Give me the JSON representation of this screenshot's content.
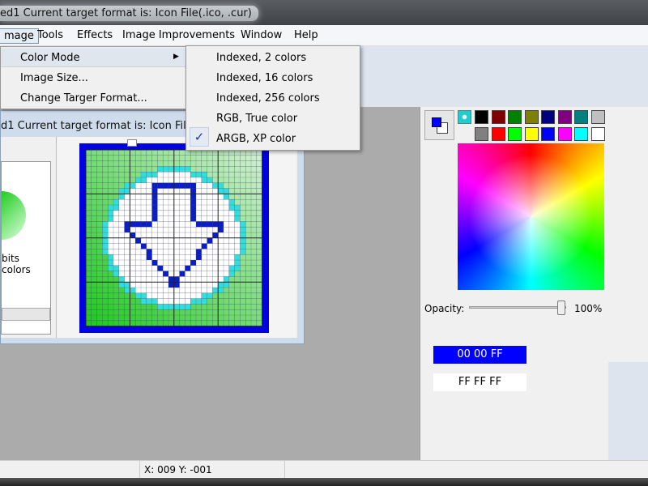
{
  "window": {
    "title": "ed1  Current target format is: Icon File(.ico, .cur)"
  },
  "menubar": [
    "mage",
    "Tools",
    "Effects",
    "Image Improvements",
    "Window",
    "Help"
  ],
  "image_menu": {
    "items": [
      "Color Mode",
      "Image Size...",
      "Change Targer Format..."
    ],
    "submenu_arrow": "triangle-right-icon"
  },
  "color_mode_submenu": {
    "items": [
      "Indexed, 2 colors",
      "Indexed, 16 colors",
      "Indexed, 256 colors",
      "RGB, True color",
      "ARGB, XP color"
    ],
    "checked": "ARGB, XP color"
  },
  "child_window": {
    "title": "d1  Current target format is: Icon File(.",
    "preview_label": "bits colors"
  },
  "palette": {
    "row1": [
      "#000000",
      "#800000",
      "#008000",
      "#808000",
      "#000080",
      "#800080",
      "#008080",
      "#c0c0c0"
    ],
    "row2": [
      "#808080",
      "#ff0000",
      "#00ff00",
      "#ffff00",
      "#0000ff",
      "#ff00ff",
      "#00ffff",
      "#ffffff"
    ],
    "foreground": "#0000ff",
    "background": "#ffffff"
  },
  "opacity": {
    "label": "Opacity:",
    "value": "100%",
    "level": 100
  },
  "colors": {
    "primary_hex": "00 00 FF",
    "secondary_hex": "FF FF FF"
  },
  "status": {
    "coords": "X: 009 Y: -001"
  }
}
